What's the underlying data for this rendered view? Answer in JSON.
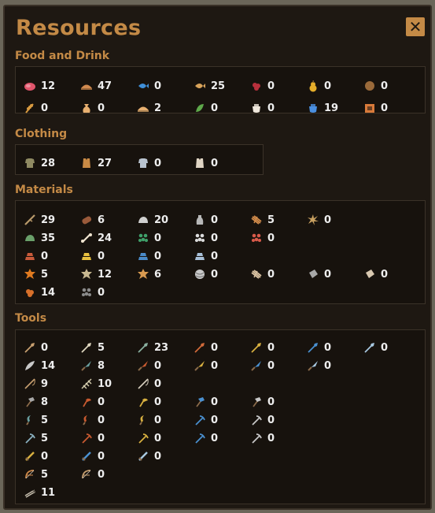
{
  "title": "Resources",
  "close_label": "✕",
  "categories": [
    {
      "name": "Food and Drink",
      "items": [
        {
          "icon": "meat-icon",
          "color": "#e0556b",
          "shape": "blob",
          "count": "12"
        },
        {
          "icon": "bread-loaf-icon",
          "color": "#d18a4f",
          "shape": "loaf",
          "count": "47"
        },
        {
          "icon": "fish-icon",
          "color": "#3f8fd8",
          "shape": "fish",
          "count": "0"
        },
        {
          "icon": "roast-fish-icon",
          "color": "#d8a35a",
          "shape": "fish",
          "count": "25"
        },
        {
          "icon": "berries-icon",
          "color": "#b8303c",
          "shape": "berries",
          "count": "0"
        },
        {
          "icon": "pear-icon",
          "color": "#e6ae2a",
          "shape": "pear",
          "count": "0"
        },
        {
          "icon": "nut-icon",
          "color": "#9a6a3a",
          "shape": "circle",
          "count": "0"
        },
        {
          "icon": "wheat-icon",
          "color": "#d89a40",
          "shape": "wheat",
          "count": "0"
        },
        {
          "icon": "flour-sack-icon",
          "color": "#e8b070",
          "shape": "sack",
          "count": "0"
        },
        {
          "icon": "bread-roll-icon",
          "color": "#e8b070",
          "shape": "loaf",
          "count": "2"
        },
        {
          "icon": "peas-icon",
          "color": "#5ea84a",
          "shape": "pod",
          "count": "0"
        },
        {
          "icon": "milk-bowl-icon",
          "color": "#efe7dc",
          "shape": "bowl",
          "count": "0"
        },
        {
          "icon": "water-flask-icon",
          "color": "#4a8fe0",
          "shape": "bowl",
          "count": "19"
        },
        {
          "icon": "storage-box-icon",
          "color": "#d87a3a",
          "shape": "crate",
          "count": "0"
        }
      ]
    },
    {
      "name": "Clothing",
      "items": [
        {
          "icon": "tunic-icon",
          "color": "#8f8a62",
          "shape": "shirt",
          "count": "28"
        },
        {
          "icon": "leather-vest-icon",
          "color": "#c98a45",
          "shape": "vest",
          "count": "27"
        },
        {
          "icon": "coat-icon",
          "color": "#b9c3cf",
          "shape": "shirt",
          "count": "0"
        },
        {
          "icon": "padded-armor-icon",
          "color": "#e0d5c4",
          "shape": "vest",
          "count": "0"
        }
      ]
    },
    {
      "name": "Materials",
      "items": [
        {
          "icon": "stick-icon",
          "color": "#b99a6a",
          "shape": "stick",
          "count": "29"
        },
        {
          "icon": "log-icon",
          "color": "#9a5a3a",
          "shape": "log",
          "count": "6"
        },
        {
          "icon": "stone-icon",
          "color": "#cfcfcf",
          "shape": "rock",
          "count": "20"
        },
        {
          "icon": "clay-icon",
          "color": "#b8b8b8",
          "shape": "bottle",
          "count": "0"
        },
        {
          "icon": "firewood-bundle-icon",
          "color": "#d08a4a",
          "shape": "bundle",
          "count": "5"
        },
        {
          "icon": "straw-icon",
          "color": "#c8a060",
          "shape": "burst",
          "count": "0"
        },
        {
          "icon": "flint-icon",
          "color": "#6aa06a",
          "shape": "rock",
          "count": "35"
        },
        {
          "icon": "bone-icon",
          "color": "#efe4cf",
          "shape": "bone",
          "count": "24"
        },
        {
          "icon": "copper-ore-icon",
          "color": "#3fa06a",
          "shape": "dots",
          "count": "0"
        },
        {
          "icon": "tin-ore-icon",
          "color": "#dcdcdc",
          "shape": "dots",
          "count": "0"
        },
        {
          "icon": "iron-ore-icon",
          "color": "#d85a4a",
          "shape": "dots",
          "count": "0"
        },
        {
          "icon": "copper-ingot-icon",
          "color": "#c85a3a",
          "shape": "ingots",
          "count": "0"
        },
        {
          "icon": "gold-ingot-icon",
          "color": "#e8c040",
          "shape": "ingots",
          "count": "0"
        },
        {
          "icon": "tin-ingot-icon",
          "color": "#4a8ac8",
          "shape": "ingots",
          "count": "0"
        },
        {
          "icon": "iron-ingot-icon",
          "color": "#a8c0d8",
          "shape": "ingots",
          "count": "0"
        },
        {
          "icon": "hide-icon",
          "color": "#e07a20",
          "shape": "star",
          "count": "5"
        },
        {
          "icon": "rawhide-icon",
          "color": "#c8b890",
          "shape": "star",
          "count": "12"
        },
        {
          "icon": "leather-icon",
          "color": "#d89a50",
          "shape": "star",
          "count": "6"
        },
        {
          "icon": "yarn-ball-icon",
          "color": "#c8c8c8",
          "shape": "ball",
          "count": "0"
        },
        {
          "icon": "rope-icon",
          "color": "#d8c0a0",
          "shape": "bundle",
          "count": "0"
        },
        {
          "icon": "cloth-icon",
          "color": "#a8a8a8",
          "shape": "cloth",
          "count": "0"
        },
        {
          "icon": "linen-icon",
          "color": "#d8c8b0",
          "shape": "cloth",
          "count": "0"
        },
        {
          "icon": "nuts-pile-icon",
          "color": "#d8702a",
          "shape": "berries",
          "count": "14"
        },
        {
          "icon": "gravel-icon",
          "color": "#8a8a8a",
          "shape": "dots",
          "count": "0"
        }
      ]
    },
    {
      "name": "Tools",
      "items": [
        {
          "icon": "wooden-spear-icon",
          "color": "#c8a070",
          "shape": "spear",
          "count": "0"
        },
        {
          "icon": "bone-spear-icon",
          "color": "#e0d8c0",
          "shape": "spear",
          "count": "5"
        },
        {
          "icon": "flint-spear-icon",
          "color": "#8ab0a0",
          "shape": "spear",
          "count": "23"
        },
        {
          "icon": "copper-spear-icon",
          "color": "#d06a3a",
          "shape": "spear",
          "count": "0"
        },
        {
          "icon": "bronze-spear-icon",
          "color": "#d8b040",
          "shape": "spear",
          "count": "0"
        },
        {
          "icon": "tin-spear-icon",
          "color": "#4a90d0",
          "shape": "spear",
          "count": "0"
        },
        {
          "icon": "iron-spear-icon",
          "color": "#a8c8e0",
          "shape": "spear",
          "count": "0"
        },
        {
          "icon": "feather-icon",
          "color": "#c8c8c8",
          "shape": "feather",
          "count": "14"
        },
        {
          "icon": "flint-knife-icon",
          "color": "#6aa0a0",
          "shape": "knife",
          "count": "8"
        },
        {
          "icon": "copper-knife-icon",
          "color": "#c85a30",
          "shape": "knife",
          "count": "0"
        },
        {
          "icon": "bronze-knife-icon",
          "color": "#d8b040",
          "shape": "knife",
          "count": "0"
        },
        {
          "icon": "tin-knife-icon",
          "color": "#4a90d0",
          "shape": "knife",
          "count": "0"
        },
        {
          "icon": "iron-knife-icon",
          "color": "#a8c8e0",
          "shape": "knife",
          "count": "0"
        },
        {
          "icon": "fishing-rod-icon",
          "color": "#c8a070",
          "shape": "rod",
          "count": "9"
        },
        {
          "icon": "fishing-net-icon",
          "color": "#d8d0b0",
          "shape": "net",
          "count": "10"
        },
        {
          "icon": "bone-fishhook-icon",
          "color": "#d8d0c0",
          "shape": "rod",
          "count": "0"
        },
        {
          "icon": "stone-hammer-icon",
          "color": "#a8a8a8",
          "shape": "hammer",
          "count": "8"
        },
        {
          "icon": "copper-axe-icon",
          "color": "#c85a30",
          "shape": "axe",
          "count": "0"
        },
        {
          "icon": "bronze-axe-icon",
          "color": "#d8b040",
          "shape": "axe",
          "count": "0"
        },
        {
          "icon": "tin-axe-icon",
          "color": "#4a90d0",
          "shape": "hammer",
          "count": "0"
        },
        {
          "icon": "iron-axe-icon",
          "color": "#c8c8c8",
          "shape": "hammer",
          "count": "0"
        },
        {
          "icon": "flint-sickle-icon",
          "color": "#6aa0a0",
          "shape": "sickle",
          "count": "5"
        },
        {
          "icon": "copper-sickle-icon",
          "color": "#c85a30",
          "shape": "sickle",
          "count": "0"
        },
        {
          "icon": "bronze-sickle-icon",
          "color": "#d8b040",
          "shape": "sickle",
          "count": "0"
        },
        {
          "icon": "tin-pick-icon",
          "color": "#4a90d0",
          "shape": "pick",
          "count": "0"
        },
        {
          "icon": "iron-pick-icon",
          "color": "#c8c8c8",
          "shape": "pick",
          "count": "0"
        },
        {
          "icon": "flint-pick-icon",
          "color": "#8ab0c0",
          "shape": "pick",
          "count": "5"
        },
        {
          "icon": "copper-pick-icon",
          "color": "#c85a30",
          "shape": "pick",
          "count": "0"
        },
        {
          "icon": "bronze-pick-icon",
          "color": "#d8b040",
          "shape": "pick",
          "count": "0"
        },
        {
          "icon": "tin-hoe-icon",
          "color": "#4a90d0",
          "shape": "pick",
          "count": "0"
        },
        {
          "icon": "iron-hoe-icon",
          "color": "#c8c8c8",
          "shape": "pick",
          "count": "0"
        },
        {
          "icon": "bronze-sword-icon",
          "color": "#d8b040",
          "shape": "sword",
          "count": "0"
        },
        {
          "icon": "tin-sword-icon",
          "color": "#4a90d0",
          "shape": "sword",
          "count": "0"
        },
        {
          "icon": "iron-sword-icon",
          "color": "#a8c8e0",
          "shape": "sword",
          "count": "0"
        },
        {
          "icon": "wooden-bow-icon",
          "color": "#d08a4a",
          "shape": "bow",
          "count": "5"
        },
        {
          "icon": "composite-bow-icon",
          "color": "#c8a070",
          "shape": "bow",
          "count": "0"
        },
        {
          "icon": "arrows-icon",
          "color": "#c8c0b0",
          "shape": "arrows",
          "count": "11"
        }
      ]
    }
  ]
}
